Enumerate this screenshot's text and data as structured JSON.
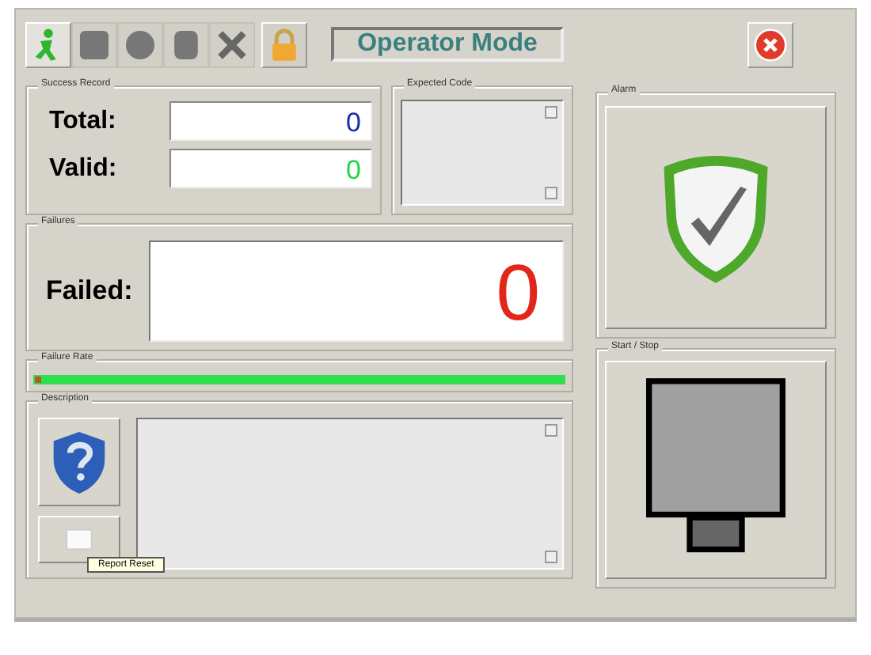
{
  "toolbar": {
    "tabs": [
      {
        "selected": true
      },
      {
        "selected": false
      },
      {
        "selected": false
      },
      {
        "selected": false
      },
      {
        "selected": false
      },
      {
        "selected": false
      }
    ],
    "mode": "Operator Mode"
  },
  "success_record": {
    "title": "Success Record",
    "fields": [
      {
        "label": "Total:",
        "value": "0",
        "color": "#1a2fa8"
      },
      {
        "label": "Valid:",
        "value": "0",
        "color": "#2ad44a"
      }
    ]
  },
  "expected_code": {
    "title": "Expected Code"
  },
  "failures": {
    "title": "Failures",
    "label": "Failed:",
    "value": "0"
  },
  "failure_rate": {
    "title": "Failure Rate",
    "level": 1
  },
  "description": {
    "title": "Description",
    "tooltip": "Report Reset"
  },
  "alarm": {
    "title": "Alarm"
  },
  "start_stop": {
    "title": "Start / Stop"
  }
}
